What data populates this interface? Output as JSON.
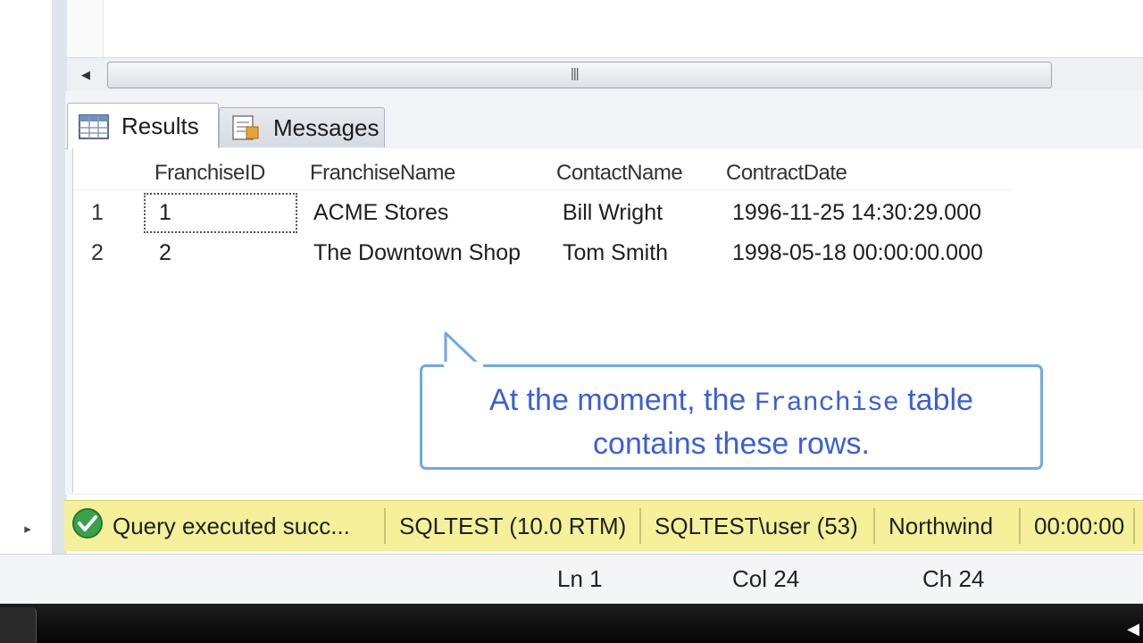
{
  "results_tabs": [
    {
      "label": "Results",
      "icon": "grid-icon"
    },
    {
      "label": "Messages",
      "icon": "messages-icon"
    }
  ],
  "grid": {
    "columns": [
      "FranchiseID",
      "FranchiseName",
      "ContactName",
      "ContractDate"
    ],
    "rows": [
      {
        "num": "1",
        "cells": [
          "1",
          "ACME Stores",
          "Bill Wright",
          "1996-11-25 14:30:29.000"
        ]
      },
      {
        "num": "2",
        "cells": [
          "2",
          "The Downtown Shop",
          "Tom Smith",
          "1998-05-18 00:00:00.000"
        ]
      }
    ]
  },
  "callout": {
    "text_before": "At the moment, the",
    "code": "Franchise",
    "text_after": "table",
    "line2": "contains these rows."
  },
  "status_bar": {
    "message": "Query executed succ...",
    "server": "SQLTEST (10.0 RTM)",
    "user": "SQLTEST\\user (53)",
    "database": "Northwind",
    "elapsed": "00:00:00"
  },
  "editor_status": {
    "line": "Ln 1",
    "column": "Col 24",
    "char": "Ch 24"
  },
  "colors": {
    "status_bar": "#f6f09a",
    "callout_border": "#6fa8e6",
    "callout_text": "#3b5fd6",
    "success": "#3aa24a"
  }
}
